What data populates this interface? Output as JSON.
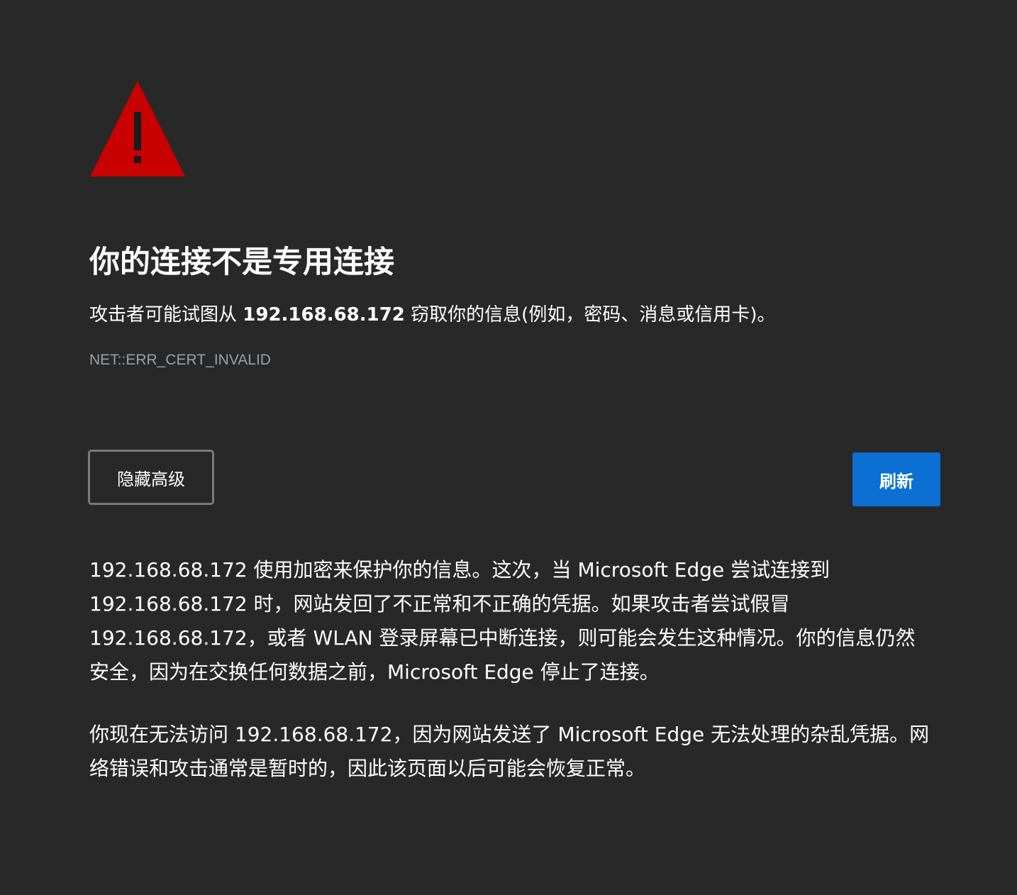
{
  "page": {
    "title": "你的连接不是专用连接",
    "summary_prefix": "攻击者可能试图从 ",
    "summary_host": "192.168.68.172",
    "summary_suffix": " 窃取你的信息(例如，密码、消息或信用卡)。",
    "error_code": "NET::ERR_CERT_INVALID"
  },
  "buttons": {
    "advanced_label": "隐藏高级",
    "refresh_label": "刷新"
  },
  "details": {
    "paragraph_1": "192.168.68.172 使用加密来保护你的信息。这次，当 Microsoft Edge 尝试连接到 192.168.68.172 时，网站发回了不正常和不正确的凭据。如果攻击者尝试假冒 192.168.68.172，或者 WLAN 登录屏幕已中断连接，则可能会发生这种情况。你的信息仍然安全，因为在交换任何数据之前，Microsoft Edge 停止了连接。",
    "paragraph_2": "你现在无法访问 192.168.68.172，因为网站发送了 Microsoft Edge 无法处理的杂乱凭据。网络错误和攻击通常是暂时的，因此该页面以后可能会恢复正常。"
  },
  "colors": {
    "background": "#282828",
    "warning_red": "#c80000",
    "accent_blue": "#0b6fd3",
    "error_code_gray": "#9aa0a6"
  },
  "icons": {
    "warning": "warning-triangle-icon"
  }
}
